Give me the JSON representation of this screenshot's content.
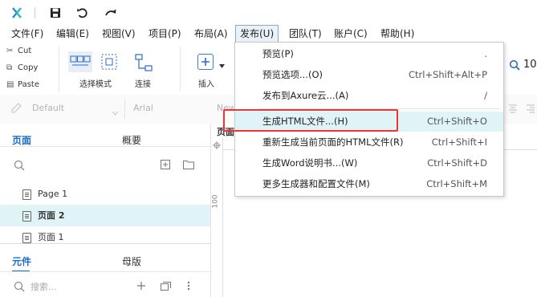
{
  "toolbar": {
    "icons": [
      "logo-icon",
      "save-icon",
      "undo-icon",
      "redo-icon"
    ]
  },
  "menubar": {
    "items": [
      "文件(F)",
      "编辑(E)",
      "视图(V)",
      "项目(P)",
      "布局(A)",
      "发布(U)",
      "团队(T)",
      "账户(C)",
      "帮助(H)"
    ]
  },
  "ribbon": {
    "cut": "Cut",
    "copy": "Copy",
    "paste": "Paste",
    "select_mode": "选择模式",
    "connect": "连接",
    "insert": "插入",
    "zoom_partial": "10"
  },
  "format": {
    "style": "Default",
    "font": "Arial",
    "new": "New"
  },
  "left": {
    "tab_pages": "页面",
    "tab_outline": "概要",
    "pages": [
      "Page 1",
      "页面 2",
      "页面 1"
    ],
    "tab_widgets": "元件",
    "tab_masters": "母版",
    "search_placeholder": "搜索..."
  },
  "canvas": {
    "page_tab_partial": "页面",
    "ruler_label": "100"
  },
  "dropdown": {
    "items": [
      {
        "label": "预览(P)",
        "shortcut": "."
      },
      {
        "label": "预览选项...(O)",
        "shortcut": "Ctrl+Shift+Alt+P"
      },
      {
        "label": "发布到Axure云...(A)",
        "shortcut": "/"
      },
      {
        "label": "生成HTML文件...(H)",
        "shortcut": "Ctrl+Shift+O"
      },
      {
        "label": "重新生成当前页面的HTML文件(R)",
        "shortcut": "Ctrl+Shift+I"
      },
      {
        "label": "生成Word说明书...(W)",
        "shortcut": "Ctrl+Shift+D"
      },
      {
        "label": "更多生成器和配置文件(M)",
        "shortcut": "Ctrl+Shift+M"
      }
    ]
  },
  "colors": {
    "accent": "#1a6ec5",
    "highlight": "#e0f4f7",
    "red_box": "#ee3333"
  }
}
